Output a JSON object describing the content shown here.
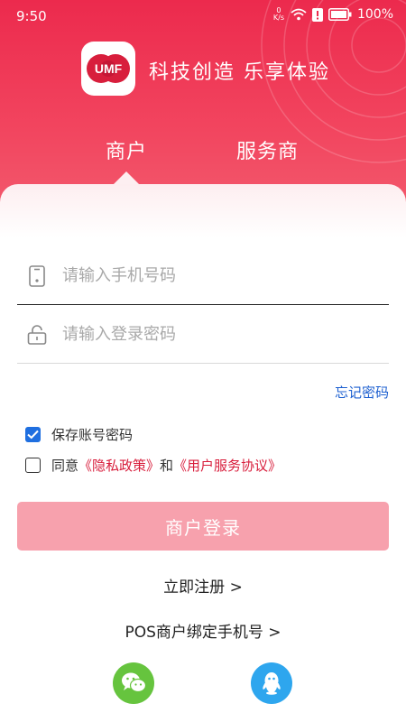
{
  "status_bar": {
    "time": "9:50",
    "speed_value": "0",
    "speed_unit": "K/s",
    "battery": "100%"
  },
  "brand": {
    "logo_text": "UMF",
    "slogan": "科技创造 乐享体验"
  },
  "tabs": [
    {
      "label": "商户",
      "selected": true
    },
    {
      "label": "服务商",
      "selected": false
    }
  ],
  "form": {
    "phone_placeholder": "请输入手机号码",
    "phone_value": "",
    "password_placeholder": "请输入登录密码",
    "password_value": "",
    "forgot_label": "忘记密码",
    "save_label": "保存账号密码",
    "save_checked": true,
    "agree_prefix": "同意",
    "privacy_link": "《隐私政策》",
    "agree_and": "和",
    "service_link": "《用户服务协议》",
    "agree_checked": false,
    "login_label": "商户登录"
  },
  "links": {
    "register": "立即注册 >",
    "bind_phone": "POS商户绑定手机号 >"
  },
  "social": [
    "wechat-icon",
    "qq-icon"
  ],
  "colors": {
    "brand_red": "#ec2a4d",
    "button_disabled": "#f7a1ad",
    "link_blue": "#1c5fd0",
    "link_red": "#d81e3c",
    "checkbox_blue": "#1f6fe0",
    "wechat_green": "#66c43e",
    "qq_blue": "#2ea6ee"
  }
}
